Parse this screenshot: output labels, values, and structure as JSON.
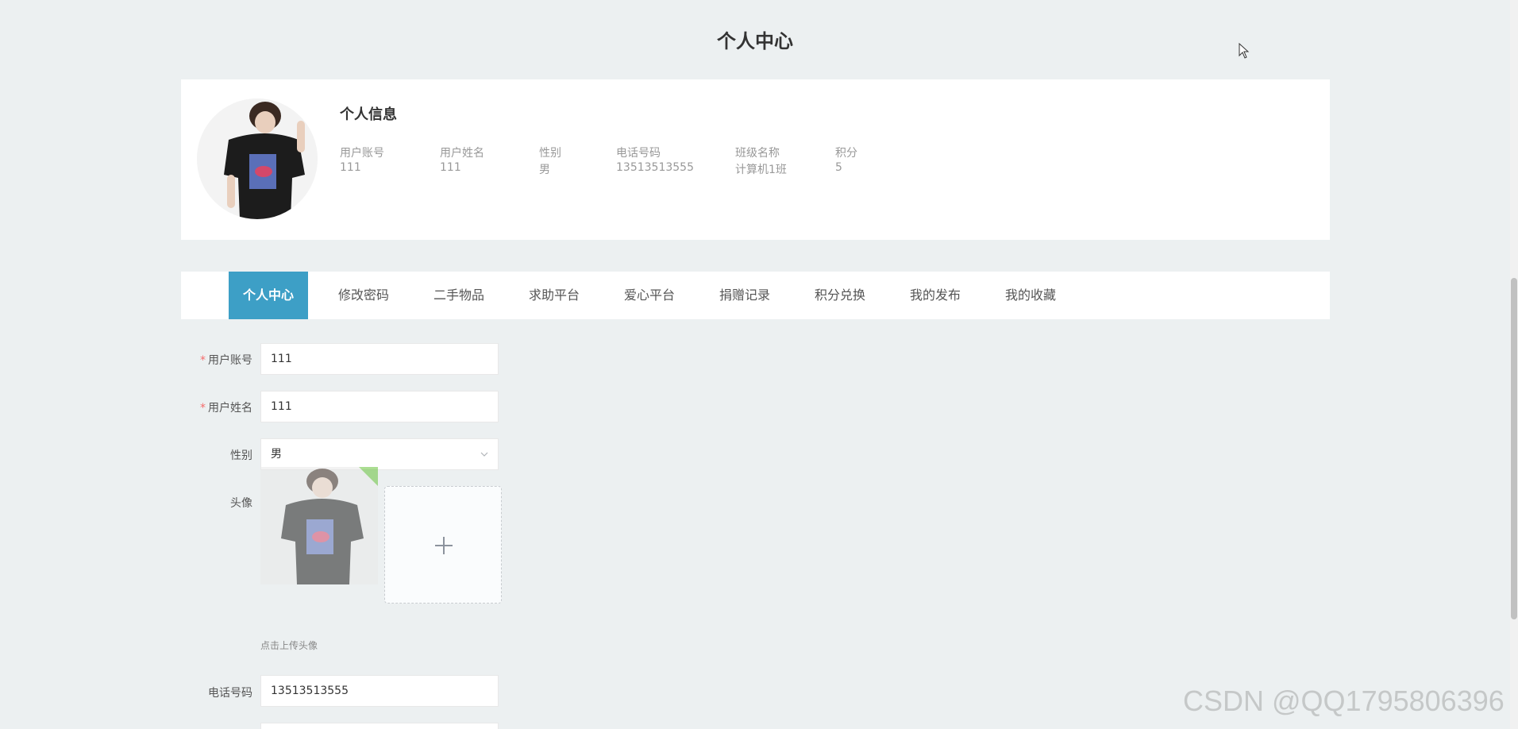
{
  "page_title": "个人中心",
  "profile": {
    "heading": "个人信息",
    "fields": [
      {
        "label": "用户账号",
        "value": "111"
      },
      {
        "label": "用户姓名",
        "value": "111"
      },
      {
        "label": "性别",
        "value": "男"
      },
      {
        "label": "电话号码",
        "value": "13513513555"
      },
      {
        "label": "班级名称",
        "value": "计算机1班"
      },
      {
        "label": "积分",
        "value": "5"
      }
    ]
  },
  "tabs": [
    {
      "label": "个人中心",
      "active": true
    },
    {
      "label": "修改密码"
    },
    {
      "label": "二手物品"
    },
    {
      "label": "求助平台"
    },
    {
      "label": "爱心平台"
    },
    {
      "label": "捐赠记录"
    },
    {
      "label": "积分兑换"
    },
    {
      "label": "我的发布"
    },
    {
      "label": "我的收藏"
    }
  ],
  "form": {
    "account": {
      "label": "用户账号",
      "required_mark": "*",
      "value": "111"
    },
    "name": {
      "label": "用户姓名",
      "required_mark": "*",
      "value": "111"
    },
    "gender": {
      "label": "性别",
      "value": "男"
    },
    "avatar": {
      "label": "头像",
      "tip": "点击上传头像"
    },
    "phone": {
      "label": "电话号码",
      "value": "13513513555"
    }
  },
  "icons": {
    "select": "chevron-down-icon",
    "upload": "plus-icon",
    "cursor": "mouse-cursor-icon"
  },
  "colors": {
    "accent": "#3d9fc6",
    "background": "#ecf0f1",
    "required": "#f56c6c"
  },
  "watermark": "CSDN @QQ1795806396"
}
